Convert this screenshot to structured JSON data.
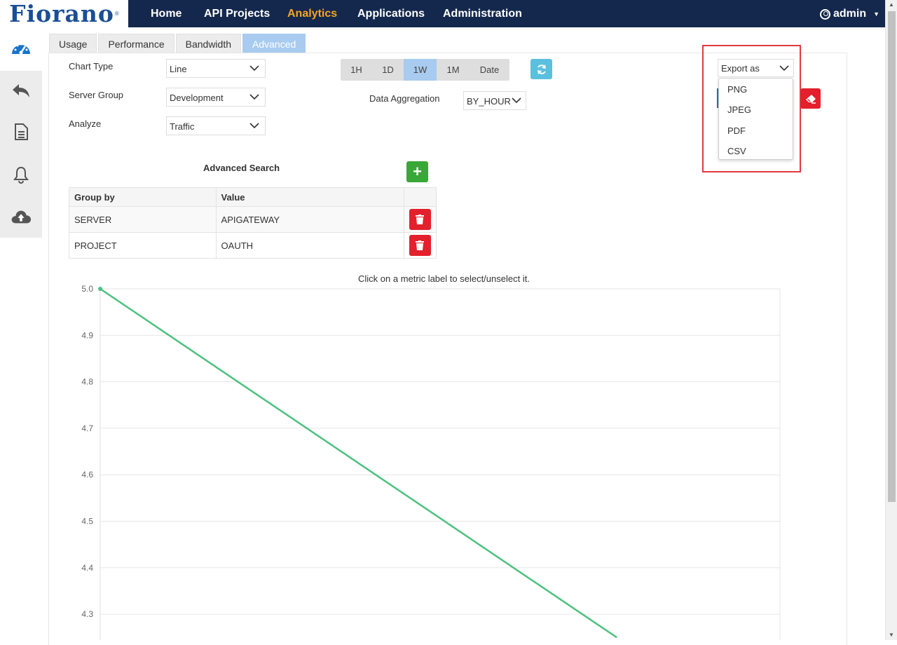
{
  "logo": {
    "text": "Fiorano"
  },
  "nav": {
    "items": [
      {
        "label": "Home"
      },
      {
        "label": "API Projects"
      },
      {
        "label": "Analytics"
      },
      {
        "label": "Applications"
      },
      {
        "label": "Administration"
      }
    ],
    "user": "admin"
  },
  "sidebar": {
    "icons": [
      "dashboard-gauge-icon",
      "reply-arrow-icon",
      "document-icon",
      "bell-icon",
      "cloud-upload-icon"
    ]
  },
  "tabs": [
    {
      "label": "Usage"
    },
    {
      "label": "Performance"
    },
    {
      "label": "Bandwidth"
    },
    {
      "label": "Advanced"
    }
  ],
  "form": {
    "chart_type_label": "Chart Type",
    "chart_type_value": "Line",
    "server_group_label": "Server Group",
    "server_group_value": "Development",
    "analyze_label": "Analyze",
    "analyze_value": "Traffic",
    "data_aggregation_label": "Data Aggregation",
    "data_aggregation_value": "BY_HOUR"
  },
  "time_range": {
    "options": [
      "1H",
      "1D",
      "1W",
      "1M",
      "Date"
    ],
    "selected": "1W"
  },
  "export": {
    "label": "Export as",
    "options": [
      "PNG",
      "JPEG",
      "PDF",
      "CSV"
    ]
  },
  "advanced_search": {
    "title": "Advanced Search",
    "headers": [
      "Group by",
      "Value"
    ],
    "rows": [
      {
        "group_by": "SERVER",
        "value": "APIGATEWAY"
      },
      {
        "group_by": "PROJECT",
        "value": "OAUTH"
      }
    ]
  },
  "chart_hint": "Click on a metric label to select/unselect it.",
  "chart_data": {
    "type": "line",
    "ylabel": "",
    "xlabel": "",
    "ylim": [
      4.25,
      5.0
    ],
    "yticks": [
      "5.0",
      "4.9",
      "4.8",
      "4.7",
      "4.6",
      "4.5",
      "4.4",
      "4.3"
    ],
    "series": [
      {
        "values": [
          5.0,
          4.25
        ],
        "x": [
          0,
          0.76
        ],
        "color": "#4cc17f"
      }
    ],
    "grid": true
  },
  "colors": {
    "nav_bg": "#14284d",
    "accent_orange": "#f7a521",
    "selected_tab": "#a8cbef",
    "danger": "#e3202c",
    "success": "#38a838",
    "info": "#5bc0de",
    "line": "#4cc17f"
  }
}
